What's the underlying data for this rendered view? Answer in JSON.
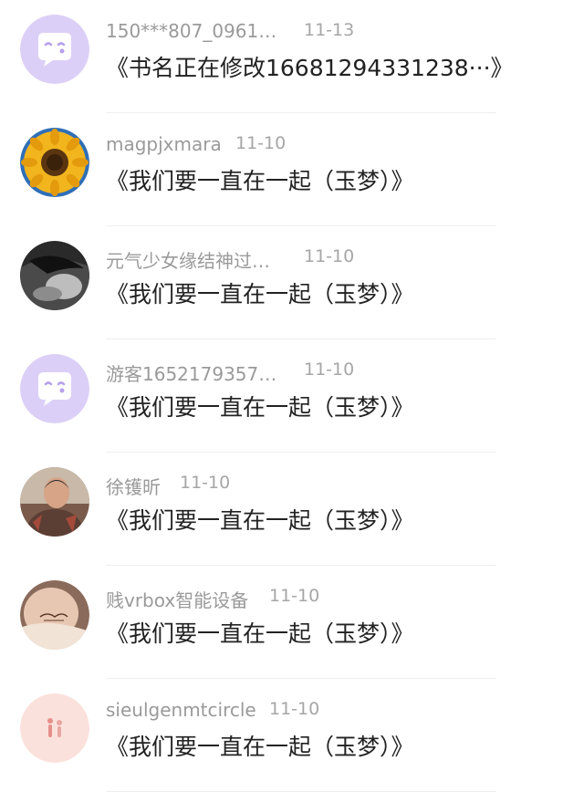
{
  "colors": {
    "purple_avatar_bg": "#dccff7",
    "purple_bubble": "#ffffff",
    "name_text": "#9a9a9a",
    "time_text": "#a6a6a6",
    "title_text": "#222222",
    "divider": "#eeeeee"
  },
  "messages": [
    {
      "user": "150***807_0961…",
      "time": "11-13",
      "title": "《书名正在修改16681294331238···》",
      "avatar_icon": "chat-bubble-icon"
    },
    {
      "user": "magpjxmara",
      "time": "11-10",
      "title": "《我们要一直在一起（玉梦）》",
      "avatar_icon": "sunflower-photo"
    },
    {
      "user": "元气少女缘结神过…",
      "time": "11-10",
      "title": "《我们要一直在一起（玉梦）》",
      "avatar_icon": "bw-portrait-photo"
    },
    {
      "user": "游客1652179357…",
      "time": "11-10",
      "title": "《我们要一直在一起（玉梦）》",
      "avatar_icon": "chat-bubble-icon"
    },
    {
      "user": "徐镬昕",
      "time": "11-10",
      "title": "《我们要一直在一起（玉梦）》",
      "avatar_icon": "man-portrait-photo"
    },
    {
      "user": "贱vrbox智能设备",
      "time": "11-10",
      "title": "《我们要一直在一起（玉梦）》",
      "avatar_icon": "tattoo-shoulder-photo"
    },
    {
      "user": "sieulgenmtcircle",
      "time": "11-10",
      "title": "《我们要一直在一起（玉梦）》",
      "avatar_icon": "pink-couple-illustration"
    }
  ]
}
